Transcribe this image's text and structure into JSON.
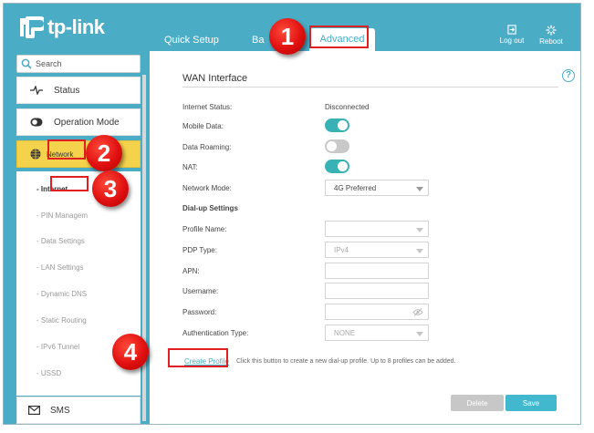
{
  "brand": {
    "name": "tp-link"
  },
  "nav": {
    "tabs": [
      {
        "label": "Quick Setup"
      },
      {
        "label": "Ba"
      },
      {
        "label": "Advanced"
      }
    ],
    "logout_label": "Log out",
    "reboot_label": "Reboot"
  },
  "sidebar": {
    "search_placeholder": "Search",
    "items": [
      {
        "label": "Status",
        "icon": "pulse-icon"
      },
      {
        "label": "Operation Mode",
        "icon": "toggle-icon"
      },
      {
        "label": "Network",
        "icon": "globe-icon"
      },
      {
        "label": "SMS",
        "icon": "envelope-icon"
      }
    ],
    "network_visible_label": "Network",
    "submenu": [
      {
        "label": "- Internet"
      },
      {
        "label": "- PIN Managem"
      },
      {
        "label": "- Data Settings"
      },
      {
        "label": "- LAN Settings"
      },
      {
        "label": "- Dynamic DNS"
      },
      {
        "label": "- Static Routing"
      },
      {
        "label": "- IPv6 Tunnel"
      },
      {
        "label": "- USSD"
      }
    ]
  },
  "main": {
    "section_title": "WAN Interface",
    "internet_status_label": "Internet Status:",
    "internet_status_value": "Disconnected",
    "mobile_data_label": "Mobile Data:",
    "mobile_data_on": true,
    "data_roaming_label": "Data Roaming:",
    "data_roaming_on": false,
    "nat_label": "NAT:",
    "nat_on": true,
    "network_mode_label": "Network Mode:",
    "network_mode_value": "4G Preferred",
    "dialup_header": "Dial-up Settings",
    "profile_name_label": "Profile Name:",
    "profile_name_value": "",
    "pdp_type_label": "PDP Type:",
    "pdp_type_value": "IPv4",
    "apn_label": "APN:",
    "username_label": "Username:",
    "password_label": "Password:",
    "auth_type_label": "Authentication Type:",
    "auth_type_value": "NONE",
    "create_profile_label": "Create Profile",
    "create_profile_desc": "Click this button to create a new dial-up profile. Up to 8 profiles can be added.",
    "delete_label": "Delete",
    "save_label": "Save"
  },
  "annotations": {
    "steps": [
      "1",
      "2",
      "3",
      "4"
    ],
    "color": "#e02020"
  },
  "colors": {
    "brand": "#4bacc6",
    "toggle_on": "#38b2b5",
    "network_highlight": "#f5d24c",
    "save_button": "#42b8cf"
  }
}
